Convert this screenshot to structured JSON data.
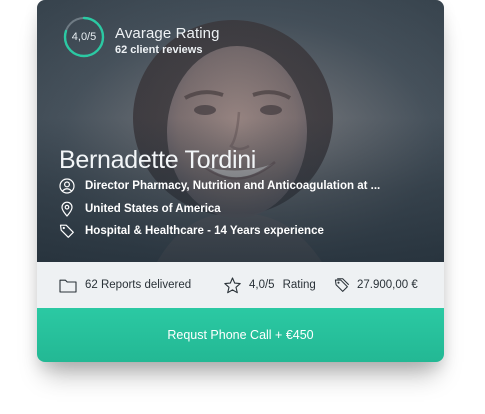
{
  "rating": {
    "value_text": "4,0/5",
    "value": 4.0,
    "max": 5,
    "title": "Avarage Rating",
    "subtitle": "62 client reviews"
  },
  "profile": {
    "name": "Bernadette Tordini",
    "role": "Director Pharmacy, Nutrition and Anticoagulation at ...",
    "location": "United States of America",
    "industry": "Hospital & Healthcare - 14 Years experience"
  },
  "stats": {
    "reports": "62 Reports delivered",
    "rating_value": "4,0/5",
    "rating_label": "Rating",
    "price": "27.900,00 €"
  },
  "cta": {
    "label": "Requst Phone Call + €450"
  },
  "icons": {
    "rating_ring": "progress-ring-icon",
    "role": "user-circle-icon",
    "location": "map-pin-icon",
    "industry": "tag-icon",
    "reports": "folder-icon",
    "rating": "star-icon",
    "price": "price-tag-icon"
  },
  "colors": {
    "accent": "#2bc9a3",
    "ring_track": "#6f7b84",
    "stats_bg": "#eef1f3",
    "text_dark": "#2a3238"
  }
}
